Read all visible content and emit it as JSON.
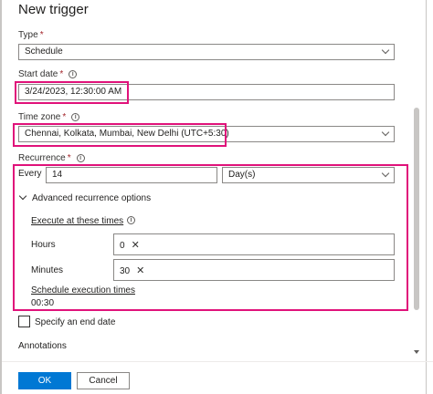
{
  "panel": {
    "title": "New trigger"
  },
  "type": {
    "label": "Type",
    "required": "*",
    "value": "Schedule"
  },
  "start_date": {
    "label": "Start date",
    "required": "*",
    "value": "3/24/2023, 12:30:00 AM"
  },
  "time_zone": {
    "label": "Time zone",
    "required": "*",
    "value": "Chennai, Kolkata, Mumbai, New Delhi (UTC+5:30)"
  },
  "recurrence": {
    "label": "Recurrence",
    "required": "*",
    "every_label": "Every",
    "interval": "14",
    "unit": "Day(s)",
    "advanced_label": "Advanced recurrence options",
    "execute_label": "Execute at these times",
    "hours_label": "Hours",
    "hours_tag": "0",
    "minutes_label": "Minutes",
    "minutes_tag": "30",
    "schedule_label": "Schedule execution times",
    "schedule_value": "00:30"
  },
  "end_date": {
    "label": "Specify an end date",
    "checked": false
  },
  "annotations": {
    "label": "Annotations"
  },
  "footer": {
    "ok_label": "OK",
    "cancel_label": "Cancel"
  },
  "icons": {
    "info": "info-icon",
    "chevron": "chevron-down-icon",
    "remove": "close-icon"
  },
  "colors": {
    "primary": "#0078d4",
    "highlight": "#e0127a",
    "required": "#a4262c"
  }
}
